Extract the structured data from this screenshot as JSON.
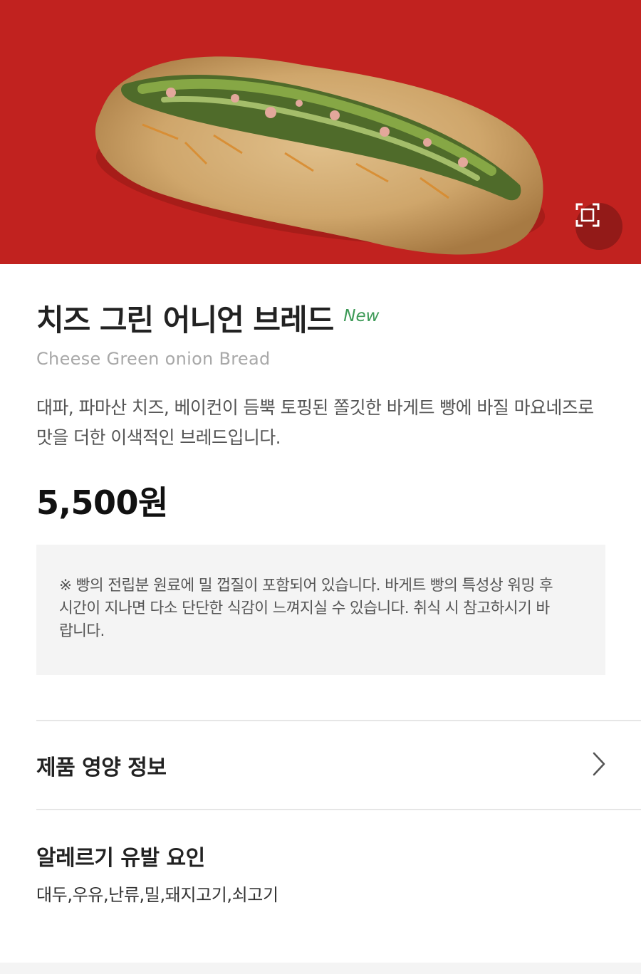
{
  "product": {
    "title": "치즈 그린 어니언 브레드",
    "badge": "New",
    "subtitle": "Cheese Green onion Bread",
    "description": "대파, 파마산 치즈, 베이컨이 듬뿍 토핑된 쫄깃한 바게트 빵에 바질 마요네즈로 맛을 더한 이색적인 브레드입니다.",
    "price": "5,500원",
    "image_icon": "bread-photo"
  },
  "notice": {
    "text": "※ 빵의 전립분 원료에 밀 껍질이 포함되어 있습니다. 바게트 빵의 특성상 워밍 후 시간이 지나면 다소 단단한 식감이 느껴지실 수 있습니다. 취식 시 참고하시기 바랍니다."
  },
  "nutrition": {
    "label": "제품 영양 정보",
    "icon": "chevron-right-icon"
  },
  "allergy": {
    "title": "알레르기 유발 요인",
    "list": "대두,우유,난류,밀,돼지고기,쇠고기"
  },
  "colors": {
    "hero_background": "#c1221f",
    "new_badge": "#3d9a57",
    "notice_background": "#f4f4f4"
  },
  "zoom_button": {
    "icon": "expand-frame-icon"
  }
}
